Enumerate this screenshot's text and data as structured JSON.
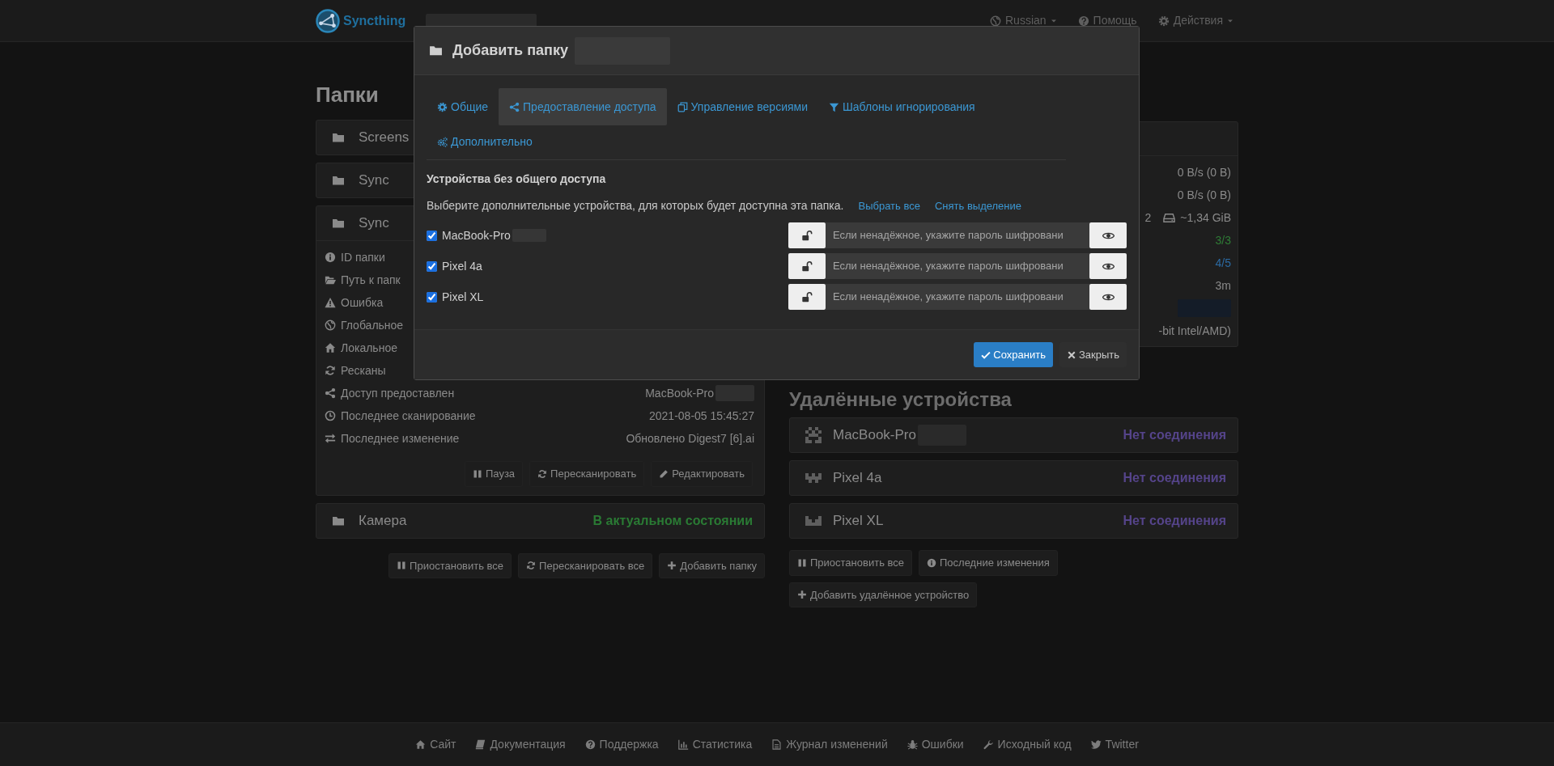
{
  "navbar": {
    "brand": "Syncthing",
    "redacted": true,
    "menus": [
      {
        "label": "Russian",
        "dropdown": true
      },
      {
        "label": "Помощь",
        "dropdown": false
      },
      {
        "label": "Действия",
        "dropdown": true
      }
    ]
  },
  "folders": {
    "title": "Папки",
    "items": [
      {
        "name": "Screens",
        "expanded": false
      },
      {
        "name": "Sync",
        "expanded": false
      },
      {
        "name": "Sync",
        "expanded": true,
        "details": [
          {
            "label": "ID папки"
          },
          {
            "label": "Путь к папк"
          },
          {
            "label": "Ошибка"
          },
          {
            "label": "Глобальное"
          },
          {
            "label": "Локальное"
          },
          {
            "label": "Ресканы"
          },
          {
            "label": "Доступ предоставлен",
            "value": "MacBook-Pro",
            "redacted": true
          },
          {
            "label": "Последнее сканирование",
            "value": "2021-08-05 15:45:27",
            "redacted": false
          },
          {
            "label": "Последнее изменение",
            "value": "Обновлено Digest7 [6].ai",
            "redacted": false
          }
        ],
        "actions": [
          "Пауза",
          "Пересканировать",
          "Редактировать"
        ]
      },
      {
        "name": "Камера",
        "expanded": false,
        "status": "В актуальном состоянии"
      }
    ],
    "actions": [
      "Приостановить все",
      "Пересканировать все",
      "Добавить папку"
    ]
  },
  "this_device": {
    "rows": [
      {
        "kind": "text",
        "value": "0 B/s (0 B)",
        "color": "#8a8a8a"
      },
      {
        "kind": "text",
        "value": "0 B/s (0 B)",
        "color": "#8a8a8a"
      },
      {
        "kind": "disk",
        "value": "2",
        "size": "~1,34 GiB"
      },
      {
        "kind": "text",
        "value": "3/3",
        "color": "#2f7d36"
      },
      {
        "kind": "text",
        "value": "4/5",
        "color": "#2b6aa3"
      },
      {
        "kind": "text",
        "value": "3m",
        "color": "#8a8a8a"
      },
      {
        "kind": "blurred"
      },
      {
        "kind": "text",
        "value": "-bit Intel/AMD)",
        "color": "#8a8a8a"
      }
    ]
  },
  "remote_devices": {
    "title": "Удалённые устройства",
    "items": [
      {
        "name": "MacBook-Pro",
        "redacted": true,
        "status": "Нет соединения"
      },
      {
        "name": "Pixel 4a",
        "redacted": false,
        "status": "Нет соединения"
      },
      {
        "name": "Pixel XL",
        "redacted": false,
        "status": "Нет соединения"
      }
    ],
    "actions": [
      "Приостановить все",
      "Последние изменения",
      "Добавить удалённое устройство"
    ]
  },
  "footer": {
    "links": [
      "Сайт",
      "Документация",
      "Поддержка",
      "Статистика",
      "Журнал изменений",
      "Ошибки",
      "Исходный код",
      "Twitter"
    ]
  },
  "dialog": {
    "title": "Добавить папку",
    "title_redacted": true,
    "tabs": [
      {
        "label": "Общие",
        "selected": false
      },
      {
        "label": "Предоставление доступа",
        "selected": true
      },
      {
        "label": "Управление версиями",
        "selected": false
      },
      {
        "label": "Шаблоны игнорирования",
        "selected": false
      },
      {
        "label": "Дополнительно",
        "selected": false
      }
    ],
    "section_title": "Устройства без общего доступа",
    "description": "Выберите дополнительные устройства, для которых будет доступна эта папка.",
    "links": [
      "Выбрать все",
      "Снять выделение"
    ],
    "devices": [
      {
        "name": "MacBook-Pro",
        "redacted": true,
        "checked": true,
        "password_placeholder": "Если ненадёжное, укажите пароль шифровани"
      },
      {
        "name": "Pixel 4a",
        "redacted": false,
        "checked": true,
        "password_placeholder": "Если ненадёжное, укажите пароль шифровани"
      },
      {
        "name": "Pixel XL",
        "redacted": false,
        "checked": true,
        "password_placeholder": "Если ненадёжное, укажите пароль шифровани"
      }
    ],
    "buttons": [
      {
        "label": "Сохранить",
        "kind": "primary"
      },
      {
        "label": "Закрыть",
        "kind": "secondary"
      }
    ]
  }
}
